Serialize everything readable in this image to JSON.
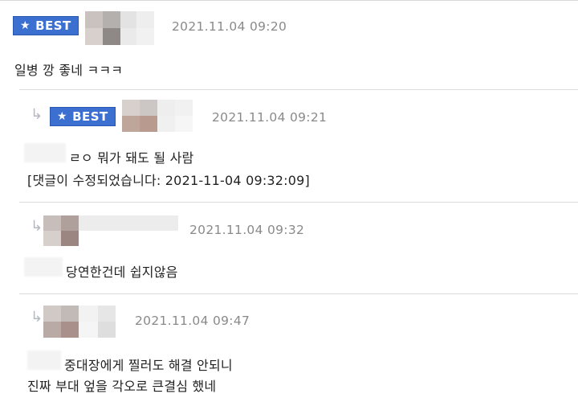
{
  "comments": [
    {
      "badge": "BEST",
      "badge_icon": "star",
      "timestamp": "2021.11.04 09:20",
      "lines": [
        "일병 깡 좋네 ㅋㅋㅋ"
      ]
    },
    {
      "reply_icon": "reply-arrow",
      "badge": "BEST",
      "badge_icon": "star",
      "timestamp": "2021.11.04 09:21",
      "lines": [
        "ㄹㅇ 뭐가 돼도 될 사람",
        "[댓글이 수정되었습니다: 2021-11-04 09:32:09]"
      ]
    },
    {
      "reply_icon": "reply-arrow",
      "timestamp": "2021.11.04 09:32",
      "lines": [
        "당연한건데 쉽지않음"
      ]
    },
    {
      "reply_icon": "reply-arrow",
      "timestamp": "2021.11.04 09:47",
      "lines": [
        "중대장에게 찔러도 해결 안되니",
        "진짜 부대 엎을 각오로 큰결심 했네"
      ]
    }
  ],
  "colors": {
    "badge_bg": "#3b6fd0",
    "timestamp": "#8a8a8a",
    "separator": "#dcdcdc",
    "reply_arrow": "#b5b8c2"
  }
}
